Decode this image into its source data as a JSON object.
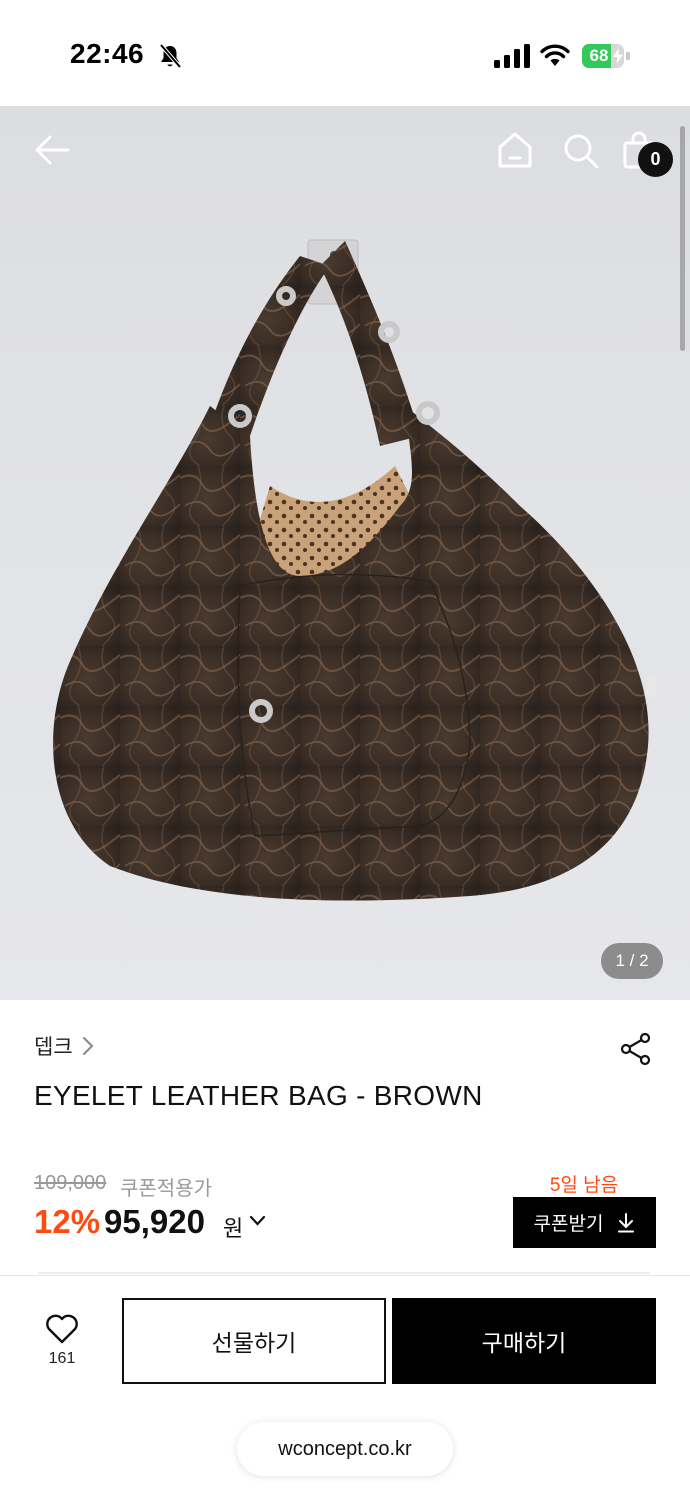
{
  "status_bar": {
    "time": "22:46",
    "battery_percent": "68",
    "battery_level": 0.68,
    "icons": [
      "bell-off-icon",
      "cellular-signal-icon",
      "wifi-icon",
      "battery-charging-icon"
    ]
  },
  "header": {
    "icons": [
      "back-arrow-icon",
      "home-icon",
      "search-icon",
      "shopping-bag-icon"
    ],
    "cart_count": "0"
  },
  "gallery": {
    "counter": "1 / 2"
  },
  "product": {
    "brand": "뎁크",
    "title": "EYELET LEATHER BAG - BROWN",
    "original_price": "109,000",
    "coupon_price_label": "쿠폰적용가",
    "discount_rate": "12%",
    "final_price": "95,920",
    "currency": "원",
    "days_left": "5일 남음",
    "coupon_button": "쿠폰받기"
  },
  "bottom_bar": {
    "wish_count": "161",
    "gift_button": "선물하기",
    "buy_button": "구매하기",
    "url": "wconcept.co.kr"
  },
  "colors": {
    "accent": "#ff4a12",
    "battery": "#34c759",
    "primary_button": "#000000"
  }
}
